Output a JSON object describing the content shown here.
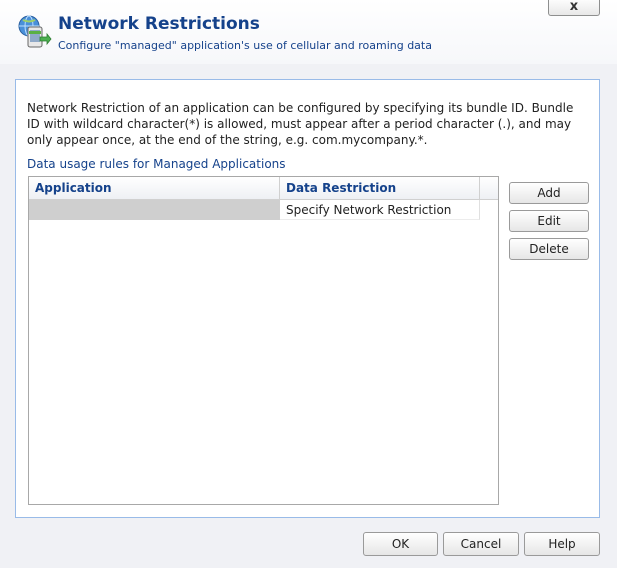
{
  "header": {
    "title": "Network Restrictions",
    "subtitle": "Configure \"managed\" application's use of cellular and roaming data",
    "close_label": "x"
  },
  "panel": {
    "description": "Network Restriction of an application can be configured by specifying its bundle ID. Bundle ID with wildcard character(*) is allowed, must appear after a period character (.), and may only appear once, at the end of the string, e.g. com.mycompany.*.",
    "section_label": "Data usage rules for Managed Applications",
    "grid": {
      "columns": [
        "Application",
        "Data Restriction"
      ],
      "rows": [
        {
          "application": "",
          "data_restriction": "Specify Network Restriction"
        }
      ]
    },
    "buttons": {
      "add": "Add",
      "edit": "Edit",
      "delete": "Delete"
    }
  },
  "footer": {
    "ok": "OK",
    "cancel": "Cancel",
    "help": "Help"
  },
  "colors": {
    "title": "#15428b",
    "panel_border": "#99bbe8",
    "background": "#f0f1f5",
    "empty_cell": "#cfcfcf"
  },
  "icons": {
    "header": "network-phone-icon"
  }
}
